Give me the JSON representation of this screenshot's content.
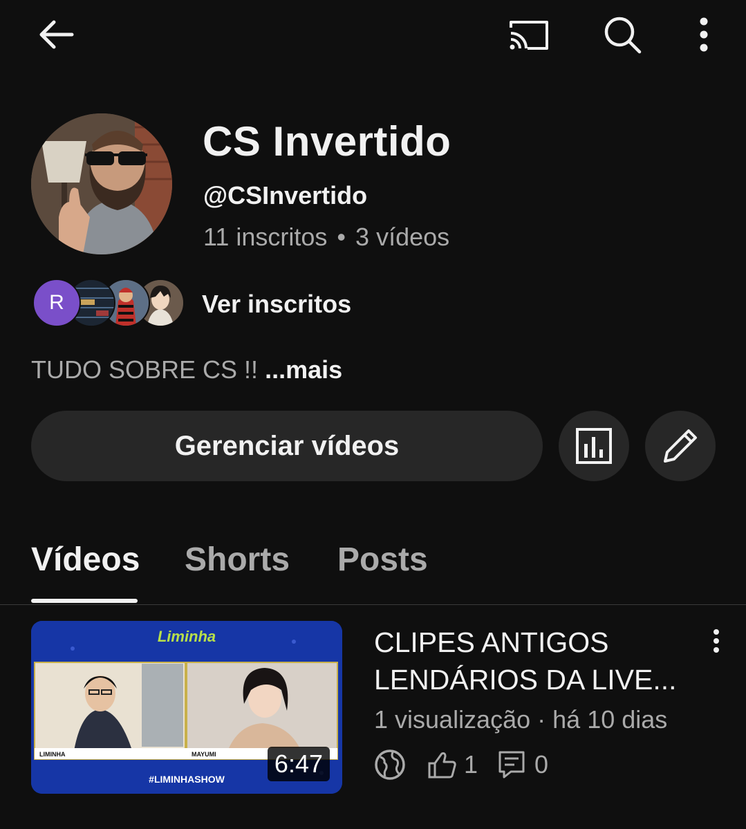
{
  "header": {
    "back_icon": "arrow-left-icon",
    "cast_icon": "cast-icon",
    "search_icon": "search-icon",
    "more_icon": "more-vertical-icon"
  },
  "channel": {
    "name": "CS Invertido",
    "handle": "@CSInvertido",
    "subscribers": "11 inscritos",
    "separator": "•",
    "videos_count": "3 vídeos",
    "subscriber_initial": "R",
    "view_subscribers": "Ver inscritos",
    "description": "TUDO SOBRE CS !!",
    "more_link": "...mais"
  },
  "actions": {
    "manage_videos": "Gerenciar vídeos",
    "analytics_icon": "analytics-icon",
    "edit_icon": "pencil-icon"
  },
  "tabs": [
    {
      "label": "Vídeos",
      "active": true
    },
    {
      "label": "Shorts",
      "active": false
    },
    {
      "label": "Posts",
      "active": false
    }
  ],
  "videos": [
    {
      "title": "CLIPES ANTIGOS LENDÁRIOS DA LIVE...",
      "views": "1 visualização",
      "separator": "·",
      "age": "há 10 dias",
      "duration": "6:47",
      "thumbnail_brand": "Liminha",
      "thumbnail_hashtag": "#LIMINHASHOW",
      "thumbnail_name_left": "LIMINHA",
      "thumbnail_name_right": "MAYUMI",
      "likes": "1",
      "comments": "0",
      "visibility_icon": "globe-icon"
    }
  ],
  "colors": {
    "background": "#0f0f0f",
    "surface": "#272727",
    "text_primary": "#f1f1f1",
    "text_secondary": "#aaaaaa",
    "subscriber_avatar": "#7a4fc9",
    "thumbnail_blue": "#1636a6"
  }
}
